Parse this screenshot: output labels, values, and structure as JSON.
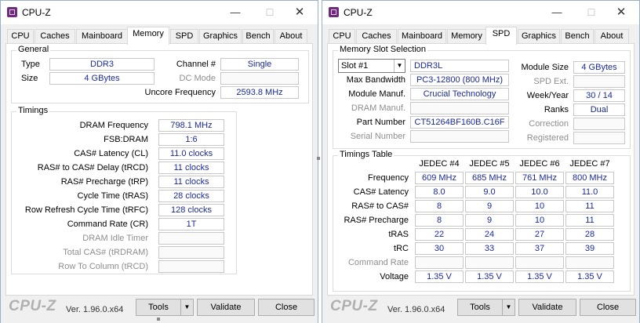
{
  "windows": [
    {
      "id": "left",
      "title": "CPU-Z",
      "tabs": [
        "CPU",
        "Caches",
        "Mainboard",
        "Memory",
        "SPD",
        "Graphics",
        "Bench",
        "About"
      ],
      "active_tab": "Memory",
      "memory": {
        "general": {
          "title": "General",
          "type_label": "Type",
          "type_value": "DDR3",
          "size_label": "Size",
          "size_value": "4 GBytes",
          "channel_label": "Channel #",
          "channel_value": "Single",
          "dc_mode_label": "DC Mode",
          "dc_mode_value": "",
          "uncore_label": "Uncore Frequency",
          "uncore_value": "2593.8 MHz"
        },
        "timings": {
          "title": "Timings",
          "rows": [
            {
              "label": "DRAM Frequency",
              "value": "798.1 MHz",
              "enabled": true
            },
            {
              "label": "FSB:DRAM",
              "value": "1:6",
              "enabled": true
            },
            {
              "label": "CAS# Latency (CL)",
              "value": "11.0 clocks",
              "enabled": true
            },
            {
              "label": "RAS# to CAS# Delay (tRCD)",
              "value": "11 clocks",
              "enabled": true
            },
            {
              "label": "RAS# Precharge (tRP)",
              "value": "11 clocks",
              "enabled": true
            },
            {
              "label": "Cycle Time (tRAS)",
              "value": "28 clocks",
              "enabled": true
            },
            {
              "label": "Row Refresh Cycle Time (tRFC)",
              "value": "128 clocks",
              "enabled": true
            },
            {
              "label": "Command Rate (CR)",
              "value": "1T",
              "enabled": true
            },
            {
              "label": "DRAM Idle Timer",
              "value": "",
              "enabled": false
            },
            {
              "label": "Total CAS# (tRDRAM)",
              "value": "",
              "enabled": false
            },
            {
              "label": "Row To Column (tRCD)",
              "value": "",
              "enabled": false
            }
          ]
        }
      },
      "footer": {
        "logo": "CPU-Z",
        "version": "Ver. 1.96.0.x64",
        "tools": "Tools",
        "validate": "Validate",
        "close": "Close"
      }
    },
    {
      "id": "right",
      "title": "CPU-Z",
      "tabs": [
        "CPU",
        "Caches",
        "Mainboard",
        "Memory",
        "SPD",
        "Graphics",
        "Bench",
        "About"
      ],
      "active_tab": "SPD",
      "spd": {
        "slot_title": "Memory Slot Selection",
        "slot_value": "Slot #1",
        "module_type": "DDR3L",
        "left_rows": [
          {
            "label": "Max Bandwidth",
            "value": "PC3-12800 (800 MHz)",
            "enabled": true
          },
          {
            "label": "Module Manuf.",
            "value": "Crucial Technology",
            "enabled": true
          },
          {
            "label": "DRAM Manuf.",
            "value": "",
            "enabled": false
          },
          {
            "label": "Part Number",
            "value": "CT51264BF160B.C16F",
            "enabled": true
          },
          {
            "label": "Serial Number",
            "value": "",
            "enabled": false
          }
        ],
        "right_rows": [
          {
            "label": "Module Size",
            "value": "4 GBytes",
            "enabled": true
          },
          {
            "label": "SPD Ext.",
            "value": "",
            "enabled": false
          },
          {
            "label": "Week/Year",
            "value": "30 / 14",
            "enabled": true
          },
          {
            "label": "Ranks",
            "value": "Dual",
            "enabled": true
          },
          {
            "label": "Correction",
            "value": "",
            "enabled": false
          },
          {
            "label": "Registered",
            "value": "",
            "enabled": false
          }
        ],
        "timings_title": "Timings Table",
        "columns": [
          "JEDEC #4",
          "JEDEC #5",
          "JEDEC #6",
          "JEDEC #7"
        ],
        "timing_rows": [
          {
            "label": "Frequency",
            "values": [
              "609 MHz",
              "685 MHz",
              "761 MHz",
              "800 MHz"
            ],
            "enabled": true
          },
          {
            "label": "CAS# Latency",
            "values": [
              "8.0",
              "9.0",
              "10.0",
              "11.0"
            ],
            "enabled": true
          },
          {
            "label": "RAS# to CAS#",
            "values": [
              "8",
              "9",
              "10",
              "11"
            ],
            "enabled": true
          },
          {
            "label": "RAS# Precharge",
            "values": [
              "8",
              "9",
              "10",
              "11"
            ],
            "enabled": true
          },
          {
            "label": "tRAS",
            "values": [
              "22",
              "24",
              "27",
              "28"
            ],
            "enabled": true
          },
          {
            "label": "tRC",
            "values": [
              "30",
              "33",
              "37",
              "39"
            ],
            "enabled": true
          },
          {
            "label": "Command Rate",
            "values": [
              "",
              "",
              "",
              ""
            ],
            "enabled": false
          },
          {
            "label": "Voltage",
            "values": [
              "1.35 V",
              "1.35 V",
              "1.35 V",
              "1.35 V"
            ],
            "enabled": true
          }
        ]
      },
      "footer": {
        "logo": "CPU-Z",
        "version": "Ver. 1.96.0.x64",
        "tools": "Tools",
        "validate": "Validate",
        "close": "Close"
      }
    }
  ]
}
